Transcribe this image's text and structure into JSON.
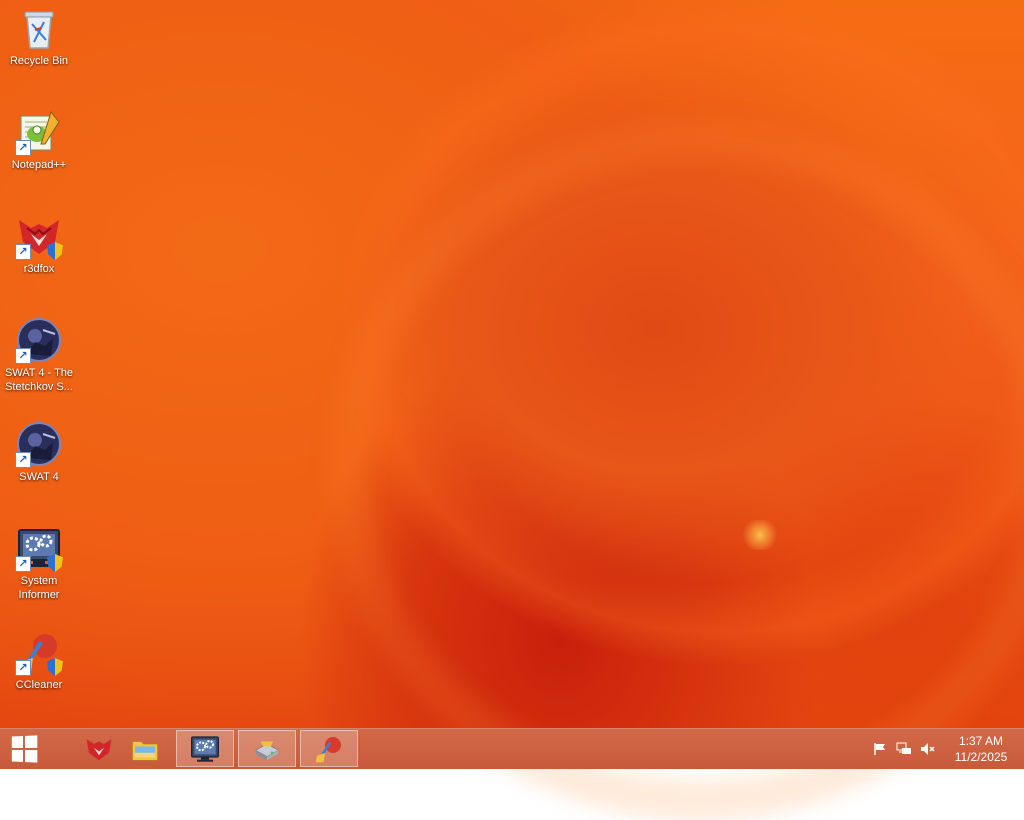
{
  "desktop": {
    "icons": [
      {
        "label": "Recycle Bin",
        "icon": "recycle-bin-icon"
      },
      {
        "label": "Notepad++",
        "icon": "notepad-plus-plus-icon",
        "shortcut": true
      },
      {
        "label": "r3dfox",
        "icon": "r3dfox-icon",
        "shortcut": true
      },
      {
        "label": "SWAT 4 - The Stetchkov S...",
        "icon": "swat4-expansion-icon",
        "shortcut": true
      },
      {
        "label": "SWAT 4",
        "icon": "swat4-icon",
        "shortcut": true
      },
      {
        "label": "System Informer",
        "icon": "system-informer-icon",
        "shortcut": true
      },
      {
        "label": "CCleaner",
        "icon": "ccleaner-icon",
        "shortcut": true
      }
    ]
  },
  "taskbar": {
    "start": {
      "icon": "windows-start-icon"
    },
    "pinned": [
      {
        "name": "r3dfox",
        "icon": "r3dfox-icon",
        "active": false
      },
      {
        "name": "File Explorer",
        "icon": "file-explorer-icon",
        "active": false
      },
      {
        "name": "System Informer",
        "icon": "system-informer-icon",
        "active": true
      },
      {
        "name": "Drive tool",
        "icon": "drive-icon",
        "active": true
      },
      {
        "name": "CCleaner",
        "icon": "ccleaner-icon",
        "active": true
      }
    ],
    "tray": {
      "icons": [
        "action-center-flag-icon",
        "network-icon",
        "volume-muted-icon"
      ],
      "time": "1:37 AM",
      "date": "11/2/2025"
    }
  },
  "colors": {
    "wallpaper_primary": "#f2601a",
    "wallpaper_dark": "#c8200c",
    "taskbar": "#cc6040"
  }
}
